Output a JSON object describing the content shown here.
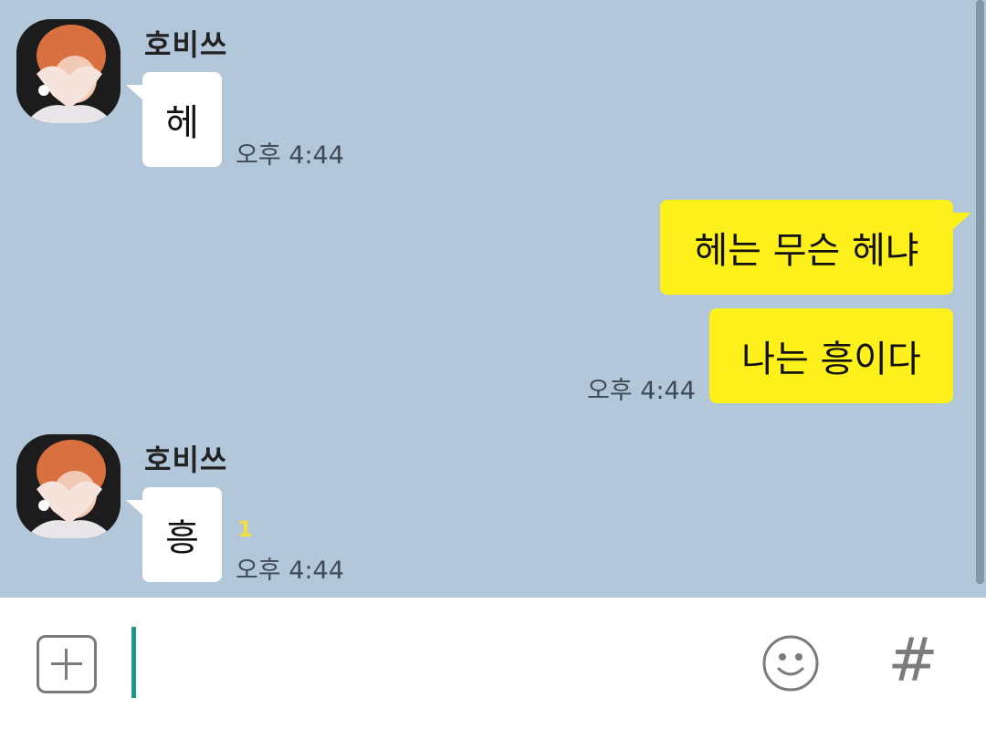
{
  "colors": {
    "chat_background": "#b2c7da",
    "outgoing_bubble": "#fef01b",
    "incoming_bubble": "#ffffff",
    "cursor": "#1a9a8a",
    "unread_count": "#f4e03a"
  },
  "messages": [
    {
      "direction": "incoming",
      "sender": "호비쓰",
      "avatar_icon": "profile-photo-heart-hands",
      "text": "헤",
      "time": "오후 4:44"
    },
    {
      "direction": "outgoing",
      "text": "헤는 무슨 헤냐"
    },
    {
      "direction": "outgoing",
      "text": "나는 흥이다",
      "time": "오후 4:44"
    },
    {
      "direction": "incoming",
      "sender": "호비쓰",
      "avatar_icon": "profile-photo-heart-hands",
      "text": "흥",
      "unread": "1",
      "time": "오후 4:44"
    }
  ],
  "input_bar": {
    "plus_icon": "plus-square-icon",
    "message_value": "",
    "emoji_icon": "smiley-icon",
    "hash_icon": "#"
  }
}
